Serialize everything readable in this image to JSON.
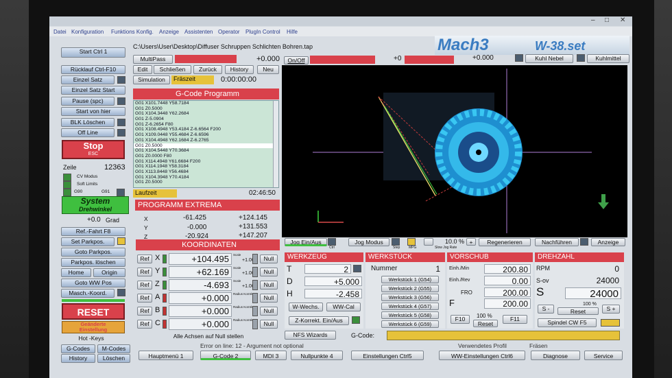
{
  "menu": [
    "Datei",
    "Konfiguration",
    "Funktions Konfig.",
    "Anzeige",
    "Assistenten",
    "Operator",
    "PlugIn Control",
    "Hilfe"
  ],
  "file_path": "C:\\Users\\User\\Desktop\\Diffuser Schruppen Schlichten Bohren.tap",
  "logo": "Mach3",
  "logo_model": "W-38.set",
  "top": {
    "multipass": "MultiPass",
    "multipass_value": "+0.000",
    "onoff": "On/Off",
    "count": "+0",
    "value2": "+0.000",
    "kuehl_nebel": "Kuhl Nebel",
    "kuehlmittel": "Kuhlmittel"
  },
  "left_buttons": [
    "Start Ctrl 1",
    "Rücklauf Ctrl-F10",
    "Einzel Satz",
    "Einzel Satz Start",
    "Pause (spc)",
    "Start von hier",
    "BLK Löschen",
    "Off Line"
  ],
  "stop": {
    "label": "Stop",
    "sub": "ESC"
  },
  "zeile": {
    "label": "Zeile",
    "value": "12363"
  },
  "status_labels": {
    "cv": "CV Modus",
    "soft": "Soft Limits",
    "g90": "G90",
    "g91": "G91"
  },
  "system": {
    "line1": "System",
    "line2": "Drehwinkel",
    "value": "+0.0",
    "unit": "Grad"
  },
  "left_buttons2": [
    "Ref.-Fahrt F8",
    "Set Parkpos.",
    "Goto Parkpos.",
    "Parkpos. löschen"
  ],
  "home_label": "Home",
  "origin_label": "Origin",
  "goto_ww": "Goto WW Pos",
  "masch_koord": "Masch.-Koord.",
  "reset": "RESET",
  "geaenderte": {
    "line1": "Geänderte",
    "line2": "Einstellung"
  },
  "hotkeys": "Hot -Keys",
  "gcodes": "G-Codes",
  "mcodes": "M-Codes",
  "history_btn": "History",
  "loeschen": "Löschen",
  "edit_row": {
    "edit": "Edit",
    "close": "Schließen",
    "back": "Zurück",
    "history": "History",
    "new": "Neu"
  },
  "simulation": {
    "label": "Simulation",
    "mode": "Fräszeit",
    "time": "0:00:00:00"
  },
  "gcode_title": "G-Code Programm",
  "gcode_lines": [
    "G01 X101.7448 Y58.7184",
    "G01 Z0.5000",
    "G01 X104.3448 Y62.2684",
    "G01 Z-5.0904",
    "G01 Z-6.2654 F80",
    "G01 X108.4948 Y53.4184 Z-6.6564 F200",
    "G01 X109.0448 Y55.4684 Z-6.6596",
    "G01 X104.4948 Y62.1684 Z-6.2765",
    "G01 Z0.5000",
    "G01 X104.5448 Y70.3684",
    "G01 Z0.0000 F80",
    "G01 X114.4948 Y61.6684 F200",
    "G01 X114.1948 Y58.3184",
    "G01 X113.8448 Y56.4684",
    "G01 X104.3948 Y70.4184",
    "G01 Z0.5000"
  ],
  "laufzeit": {
    "label": "Laufzeit",
    "value": "02:46:50"
  },
  "extrema": {
    "title": "PROGRAMM EXTREMA",
    "rows": [
      {
        "axis": "X",
        "min": "-61.425",
        "max": "+124.145"
      },
      {
        "axis": "Y",
        "min": "-0.000",
        "max": "+131.553"
      },
      {
        "axis": "Z",
        "min": "-20.924",
        "max": "+147.207"
      }
    ]
  },
  "koord": {
    "title": "KOORDINATEN",
    "rows": [
      {
        "ref": "Ref",
        "axis": "X",
        "value": "+104.495",
        "scale_lbl": "Scale",
        "scale": "+1.000",
        "null": "Null"
      },
      {
        "ref": "Ref",
        "axis": "Y",
        "value": "+62.169",
        "scale_lbl": "Scale",
        "scale": "+1.000",
        "null": "Null"
      },
      {
        "ref": "Ref",
        "axis": "Z",
        "value": "-4.693",
        "scale_lbl": "Scale",
        "scale": "+1.000",
        "null": "Null"
      },
      {
        "ref": "Ref",
        "axis": "A",
        "value": "+0.000",
        "scale_lbl": "Radius Korrekt.",
        "scale": "",
        "null": "Null"
      },
      {
        "ref": "Ref",
        "axis": "B",
        "value": "+0.000",
        "scale_lbl": "Radius Korrekt.",
        "scale": "",
        "null": "Null"
      },
      {
        "ref": "Ref",
        "axis": "C",
        "value": "+0.000",
        "scale_lbl": "Radius Korrekt.",
        "scale": "",
        "null": "Null"
      }
    ],
    "all_null": "Alle Achsen auf Null stellen"
  },
  "jog": {
    "jog_onoff": "Jog Ein/Aus",
    "ctrl": "Ctrl",
    "jog_mode": "Jog Modus",
    "step": "Step",
    "mpg": "MPG",
    "percent": "10.0 %",
    "slow": "Slow Jog Rate",
    "regen": "Regenerieren",
    "nachfuehren": "Nachführen",
    "anzeige": "Anzeige"
  },
  "werkzeug": {
    "title": "WERKZEUG",
    "t_label": "T",
    "t_value": "2",
    "d_label": "D",
    "d_value": "+5.000",
    "h_label": "H",
    "h_value": "-2.458",
    "wwechs": "W-Wechs.",
    "wwcal": "WW-Cal",
    "zkorrekt": "Z-Korrekt. Ein/Aus"
  },
  "werkstueck": {
    "title": "WERKSTÜCK",
    "nummer_label": "Nummer",
    "nummer": "1",
    "items": [
      "Werkstück 1 (G54)",
      "Werkstück 2 (G55)",
      "Werkstück 3 (G56)",
      "Werkstück 4 (G57)",
      "Werkstück 5 (G58)",
      "Werkstück 6 (G59)"
    ]
  },
  "vorschub": {
    "title": "VORSCHUB",
    "einh_min": "Einh./Min",
    "einh_min_val": "200.80",
    "einh_rev": "Einh./Rev",
    "einh_rev_val": "0.00",
    "fro": "FRO",
    "fro_val": "200.00",
    "f_label": "F",
    "f_val": "200.00",
    "f10": "F10",
    "percent": "100 %",
    "reset": "Reset",
    "f11": "F11"
  },
  "drehzahl": {
    "title": "DREHZAHL",
    "rpm": "RPM",
    "rpm_val": "0",
    "sov": "S-ov",
    "sov_val": "24000",
    "s_label": "S",
    "s_val": "24000",
    "s_minus": "S -",
    "percent": "100 %",
    "reset": "Reset",
    "s_plus": "S +",
    "spindel": "Spindel CW F5"
  },
  "nfs": "NFS Wizards",
  "gcode_input_label": "G-Code:",
  "status": {
    "error": "Error on line: 12 - Argument not optional",
    "profile_label": "Verwendetes Profil",
    "profile": "Fräsen"
  },
  "tabs": [
    "Hauptmenü 1",
    "G-Code 2",
    "MDI 3",
    "Nullpunkte 4",
    "Einstellungen Ctrl5",
    "WW-Einstellungen Ctrl6",
    "Diagnose",
    "Service"
  ],
  "colors": {
    "accent_red": "#d9414b",
    "screen_bg": "#d8dde3",
    "toolpath_cyan": "#39c7f2"
  }
}
